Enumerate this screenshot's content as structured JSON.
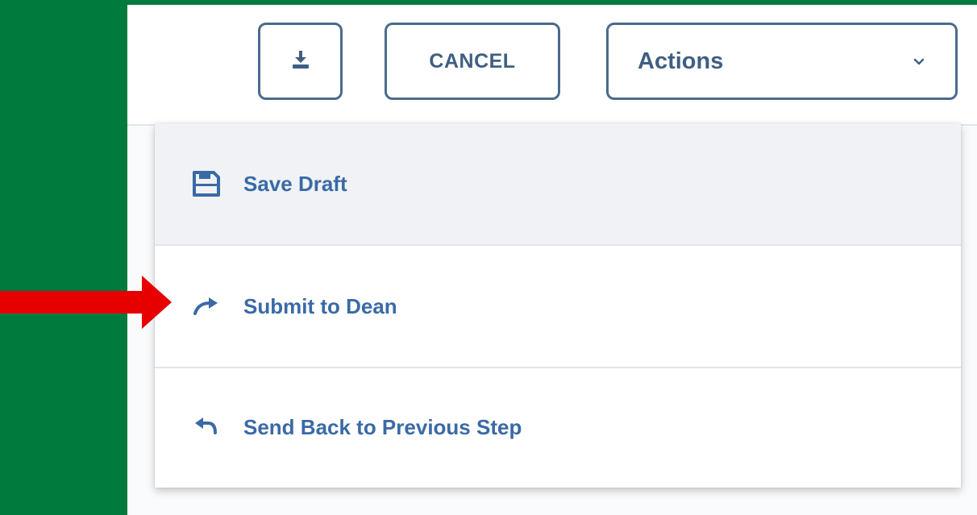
{
  "toolbar": {
    "download_icon": "download-icon",
    "cancel_label": "CANCEL",
    "actions_label": "Actions",
    "actions_chevron_icon": "chevron-down-icon"
  },
  "menu": {
    "items": [
      {
        "label": "Save Draft",
        "icon": "save-icon",
        "highlighted": true
      },
      {
        "label": "Submit to Dean",
        "icon": "forward-arrow-icon",
        "highlighted": false
      },
      {
        "label": "Send Back to Previous Step",
        "icon": "undo-arrow-icon",
        "highlighted": false
      }
    ]
  },
  "annotation": {
    "pointer_icon": "red-arrow-pointer",
    "color": "#e60000"
  },
  "colors": {
    "background_green": "#007a3d",
    "button_border": "#4a6b8c",
    "menu_text": "#3a6aa6",
    "highlight_bg": "#f0f2f5"
  }
}
